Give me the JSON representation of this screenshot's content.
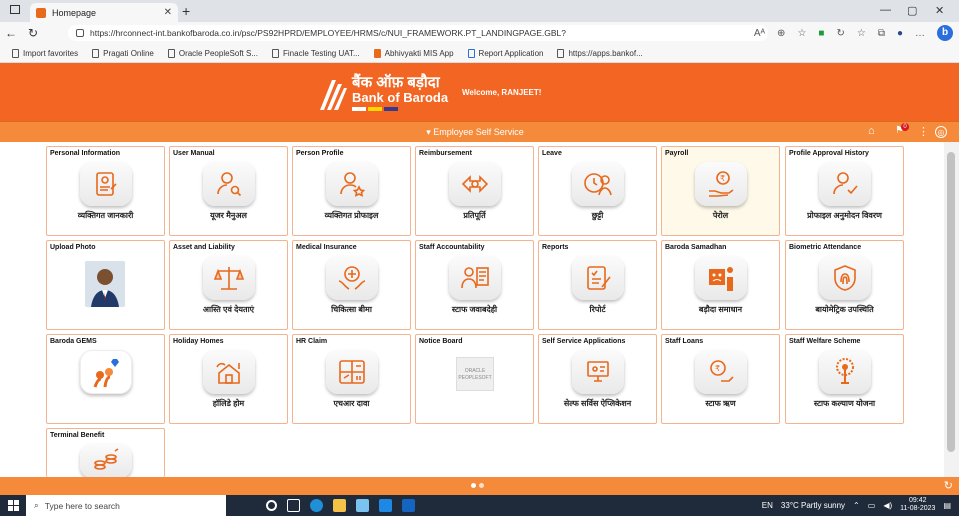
{
  "browser": {
    "tab_title": "Homepage",
    "url": "https://hrconnect-int.bankofbaroda.co.in/psc/PS92HPRD/EMPLOYEE/HRMS/c/NUI_FRAMEWORK.PT_LANDINGPAGE.GBL?",
    "favorites": [
      "Import favorites",
      "Pragati Online",
      "Oracle PeopleSoft S...",
      "Finacle Testing UAT...",
      "Abhivyakti MIS App",
      "Report Application",
      "https://apps.bankof..."
    ]
  },
  "header": {
    "logo_hindi": "बैंक ऑफ़ बड़ौदा",
    "logo_english": "Bank of Baroda",
    "welcome": "Welcome, RANJEET!",
    "nav_title": "Employee Self Service",
    "notification_count": "0"
  },
  "tiles": [
    {
      "title": "Personal Information",
      "subtitle": "व्यक्तिगत जानकारी",
      "icon": "personal-info-icon"
    },
    {
      "title": "User Manual",
      "subtitle": "यूजर मैनुअल",
      "icon": "user-manual-icon"
    },
    {
      "title": "Person Profile",
      "subtitle": "व्यक्तिगत प्रोफाइल",
      "icon": "person-profile-icon"
    },
    {
      "title": "Reimbursement",
      "subtitle": "प्रतिपूर्ति",
      "icon": "reimbursement-icon"
    },
    {
      "title": "Leave",
      "subtitle": "छुट्टी",
      "icon": "leave-icon"
    },
    {
      "title": "Payroll",
      "subtitle": "पेरोल",
      "icon": "payroll-icon"
    },
    {
      "title": "Profile Approval History",
      "subtitle": "प्रोफाइल अनुमोदन विवरण",
      "icon": "profile-approval-icon"
    },
    {
      "title": "Upload Photo",
      "subtitle": "",
      "icon": "photo"
    },
    {
      "title": "Asset and Liability",
      "subtitle": "आस्ति एवं देयताएं",
      "icon": "scales-icon"
    },
    {
      "title": "Medical Insurance",
      "subtitle": "चिकित्सा बीमा",
      "icon": "medical-icon"
    },
    {
      "title": "Staff Accountability",
      "subtitle": "स्टाफ जवाबदेही",
      "icon": "accountability-icon"
    },
    {
      "title": "Reports",
      "subtitle": "रिपोर्ट",
      "icon": "reports-icon"
    },
    {
      "title": "Baroda Samadhan",
      "subtitle": "बड़ौदा समाधान",
      "icon": "samadhan-icon"
    },
    {
      "title": "Biometric Attendance",
      "subtitle": "बायोमेट्रिक उपस्थिति",
      "icon": "fingerprint-icon"
    },
    {
      "title": "Baroda GEMS",
      "subtitle": "",
      "icon": "gems-icon"
    },
    {
      "title": "Holiday Homes",
      "subtitle": "हॉलिडे होम",
      "icon": "holiday-home-icon"
    },
    {
      "title": "HR Claim",
      "subtitle": "एचआर दावा",
      "icon": "hr-claim-icon"
    },
    {
      "title": "Notice Board",
      "subtitle": "",
      "icon": "notice-board-icon"
    },
    {
      "title": "Self Service Applications",
      "subtitle": "सेल्फ सर्विस ऐप्लिकेशन",
      "icon": "self-service-icon"
    },
    {
      "title": "Staff Loans",
      "subtitle": "स्टाफ ऋण",
      "icon": "staff-loans-icon"
    },
    {
      "title": "Staff Welfare Scheme",
      "subtitle": "स्टाफ कल्याण योजना",
      "icon": "welfare-icon"
    },
    {
      "title": "Terminal Benefit",
      "subtitle": "",
      "icon": "terminal-benefit-icon"
    }
  ],
  "oracle_text": "ORACLE PEOPLESOFT",
  "taskbar": {
    "search_placeholder": "Type here to search",
    "language": "EN",
    "weather": "33°C Partly sunny",
    "time": "09:42",
    "date": "11-08-2023"
  },
  "colors": {
    "brand_orange": "#f26522",
    "tile_border": "#f4b48f",
    "accent": "#e8681c"
  }
}
